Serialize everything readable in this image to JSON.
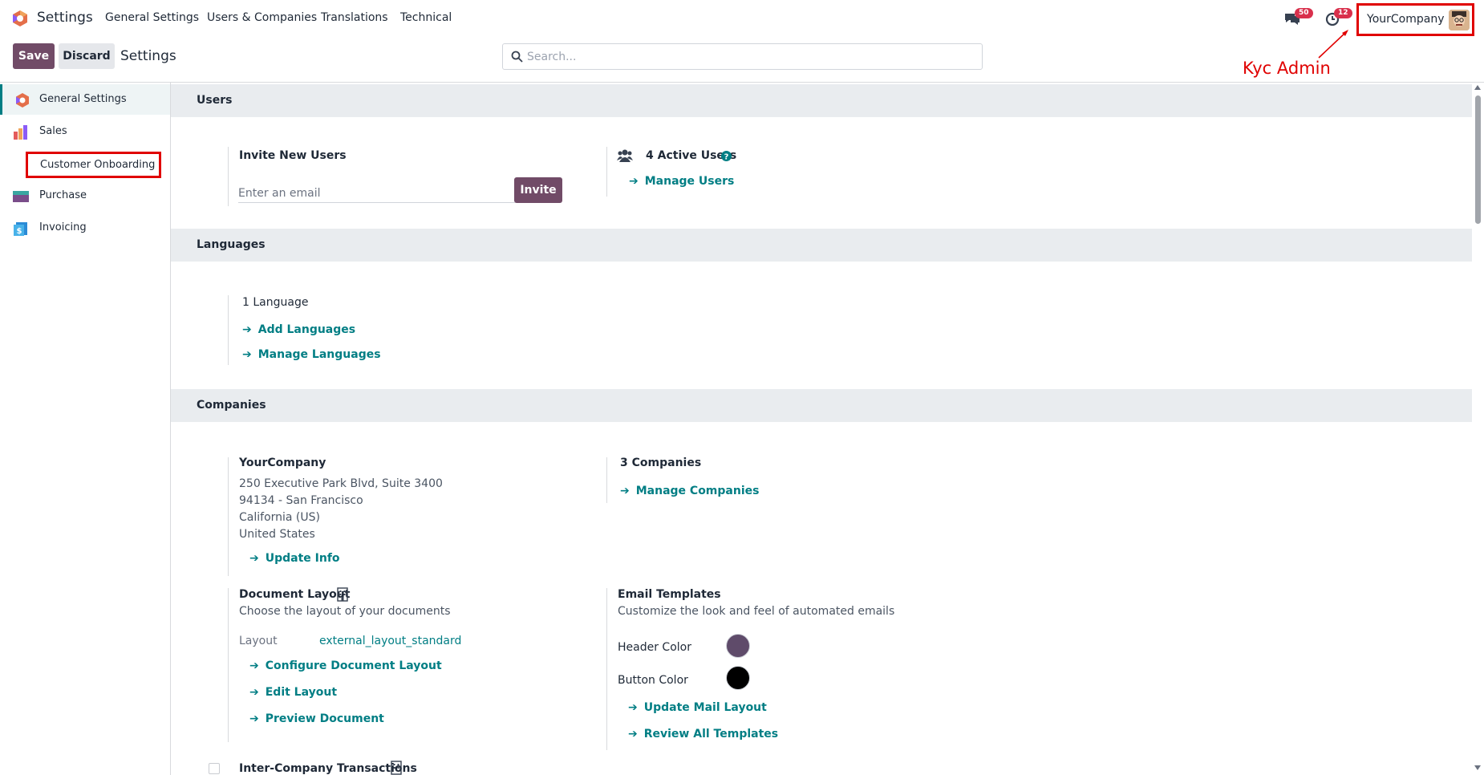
{
  "topbar": {
    "app_name": "Settings",
    "menus": [
      "General Settings",
      "Users & Companies",
      "Translations",
      "Technical"
    ],
    "messages_count": "50",
    "activities_count": "12",
    "company": "YourCompany",
    "annotation": "Kyc Admin"
  },
  "control": {
    "save_label": "Save",
    "discard_label": "Discard",
    "breadcrumb": "Settings",
    "search_placeholder": "Search..."
  },
  "sidebar": {
    "items": [
      {
        "label": "General Settings",
        "icon": "odoo-logo-icon"
      },
      {
        "label": "Sales",
        "icon": "sales-icon"
      },
      {
        "label": "Customer Onboarding",
        "icon": ""
      },
      {
        "label": "Purchase",
        "icon": "purchase-icon"
      },
      {
        "label": "Invoicing",
        "icon": "invoicing-icon"
      }
    ]
  },
  "users": {
    "header": "Users",
    "invite_title": "Invite New Users",
    "email_placeholder": "Enter an email",
    "invite_label": "Invite",
    "active_users": "4 Active Users",
    "manage_users": "Manage Users"
  },
  "languages": {
    "header": "Languages",
    "count": "1 Language",
    "add": "Add Languages",
    "manage": "Manage Languages"
  },
  "companies": {
    "header": "Companies",
    "name": "YourCompany",
    "address_1": "250 Executive Park Blvd, Suite 3400",
    "address_2": "94134 - San Francisco",
    "address_3": "California (US)",
    "address_4": "United States",
    "update_info": "Update Info",
    "count": "3 Companies",
    "manage": "Manage Companies",
    "doc_layout_title": "Document Layout",
    "doc_layout_desc": "Choose the layout of your documents",
    "layout_label": "Layout",
    "layout_value": "external_layout_standard",
    "configure_layout": "Configure Document Layout",
    "edit_layout": "Edit Layout",
    "preview_document": "Preview Document",
    "email_templates_title": "Email Templates",
    "email_templates_desc": "Customize the look and feel of automated emails",
    "header_color_label": "Header Color",
    "header_color": "#5f4b6a",
    "button_color_label": "Button Color",
    "button_color": "#000000",
    "update_mail_layout": "Update Mail Layout",
    "review_templates": "Review All Templates",
    "intercompany": "Inter-Company Transactions"
  },
  "colors": {
    "primary": "#714b67",
    "link": "#017e84",
    "annotation": "#e00000"
  }
}
